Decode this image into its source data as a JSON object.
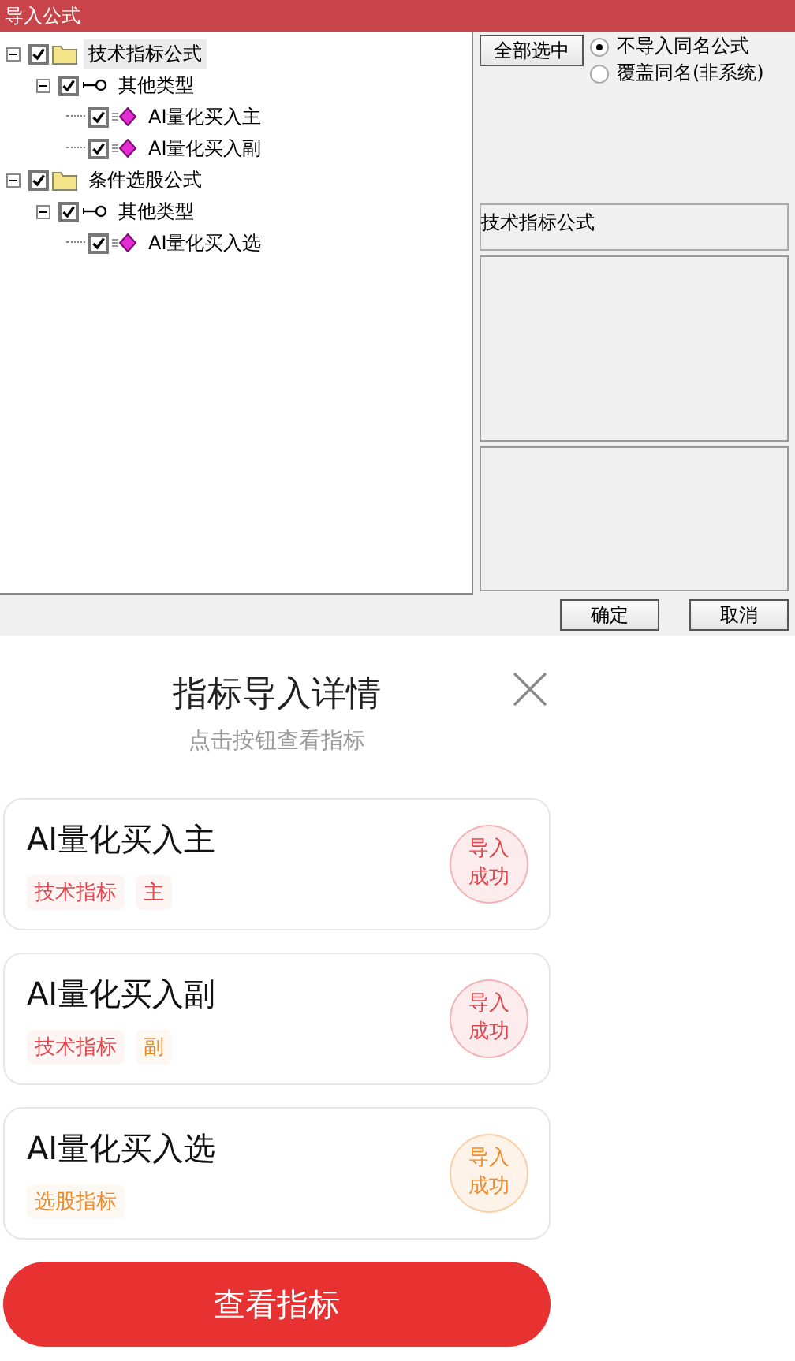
{
  "window": {
    "title": "导入公式"
  },
  "tree": [
    {
      "kind": "folder",
      "label": "技术指标公式",
      "checked": true,
      "expanded": true,
      "selected": true,
      "children": [
        {
          "kind": "type",
          "label": "其他类型",
          "checked": true,
          "expanded": true,
          "selected": false,
          "children": [
            {
              "kind": "formula",
              "label": "AI量化买入主",
              "checked": true,
              "selected": false
            },
            {
              "kind": "formula",
              "label": "AI量化买入副",
              "checked": true,
              "selected": false
            }
          ]
        }
      ]
    },
    {
      "kind": "folder",
      "label": "条件选股公式",
      "checked": true,
      "expanded": true,
      "selected": false,
      "children": [
        {
          "kind": "type",
          "label": "其他类型",
          "checked": true,
          "expanded": true,
          "selected": false,
          "children": [
            {
              "kind": "formula",
              "label": "AI量化买入选",
              "checked": true,
              "selected": false
            }
          ]
        }
      ]
    }
  ],
  "select_all_button": "全部选中",
  "options": [
    {
      "label": "不导入同名公式",
      "selected": true
    },
    {
      "label": "覆盖同名(非系统)",
      "selected": false
    }
  ],
  "info_box": "技术指标公式",
  "dialog_buttons": [
    "确定",
    "取消"
  ],
  "sheet": {
    "title": "指标导入详情",
    "subtitle": "点击按钮查看指标",
    "cards": [
      {
        "name": "AI量化买入主",
        "tags": [
          {
            "text": "技术指标",
            "color": "#e0474c"
          },
          {
            "text": "主",
            "color": "#e0474c"
          }
        ],
        "status": "导入成功",
        "color": "#e0474c"
      },
      {
        "name": "AI量化买入副",
        "tags": [
          {
            "text": "技术指标",
            "color": "#e0474c"
          },
          {
            "text": "副",
            "color": "#ee8a2c"
          }
        ],
        "status": "导入成功",
        "color": "#e0474c"
      },
      {
        "name": "AI量化买入选",
        "tags": [
          {
            "text": "选股指标",
            "color": "#ee8a2c"
          }
        ],
        "status": "导入成功",
        "color": "#ee8a2c"
      }
    ],
    "button": "查看指标"
  }
}
